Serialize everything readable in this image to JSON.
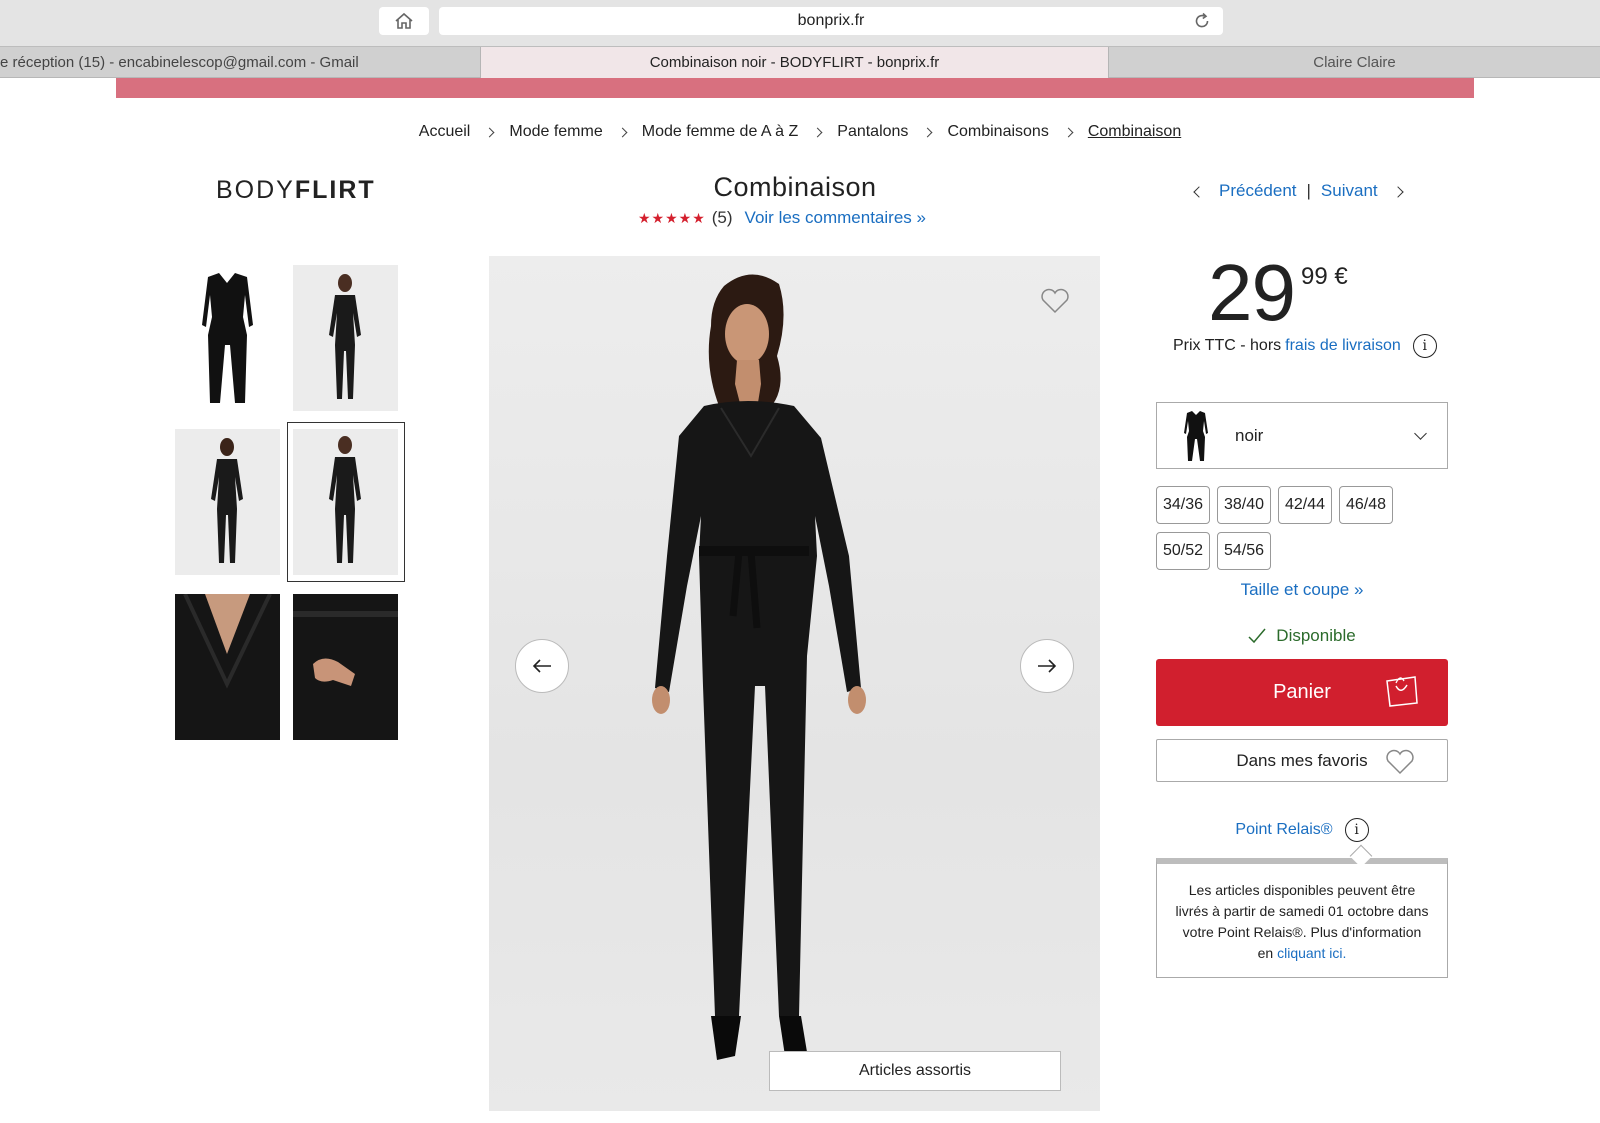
{
  "browser": {
    "url": "bonprix.fr",
    "tabs": [
      {
        "label": "e réception (15) - encabinelescop@gmail.com - Gmail"
      },
      {
        "label": "Combinaison noir - BODYFLIRT - bonprix.fr"
      },
      {
        "label": "Claire Claire"
      }
    ],
    "icons": {
      "home": "home-icon",
      "reload": "reload-icon"
    }
  },
  "breadcrumb": [
    "Accueil",
    "Mode femme",
    "Mode femme de A à Z",
    "Pantalons",
    "Combinaisons",
    "Combinaison"
  ],
  "brand": {
    "part1": "BODY",
    "part2": "FLIRT"
  },
  "product": {
    "title": "Combinaison",
    "stars": "★★★★★",
    "review_count": "(5)",
    "review_link": "Voir les commentaires »"
  },
  "nav": {
    "prev": "Précédent",
    "separator": "|",
    "next": "Suivant"
  },
  "gallery": {
    "thumbnails": [
      "thumb-flat-front",
      "thumb-model-front",
      "thumb-model-back",
      "thumb-model-front-selected",
      "thumb-detail-neckline",
      "thumb-detail-pocket"
    ],
    "selected_index": 3,
    "related_button": "Articles assortis"
  },
  "price": {
    "integer": "29",
    "decimal": "99 €",
    "note_prefix": "Prix TTC - hors",
    "note_link": "frais de livraison"
  },
  "color": {
    "selected": "noir"
  },
  "sizes": [
    "34/36",
    "38/40",
    "42/44",
    "46/48",
    "50/52",
    "54/56"
  ],
  "size_guide": "Taille et coupe »",
  "availability": "Disponible",
  "buttons": {
    "cart": "Panier",
    "favorites": "Dans mes favoris"
  },
  "relais": {
    "label": "Point Relais®",
    "text": "Les articles disponibles peuvent être livrés à partir de samedi 01 octobre dans votre Point Relais®. Plus d'information en",
    "link": "cliquant ici."
  },
  "colors": {
    "accent_red": "#d11f2e",
    "link_blue": "#1a6ec1",
    "banner_pink": "#d8707f",
    "stock_green": "#2b6b2b"
  }
}
